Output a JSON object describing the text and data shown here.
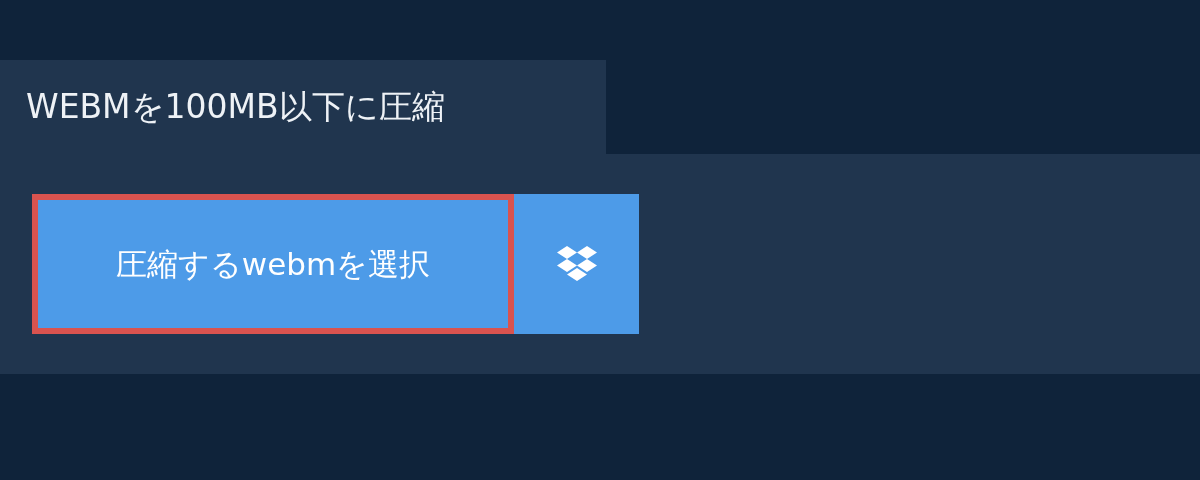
{
  "tab": {
    "title": "WEBMを100MB以下に圧縮"
  },
  "buttons": [
    {
      "kind": "select",
      "label": "圧縮するwebmを選択",
      "focused": true
    },
    {
      "kind": "dropbox",
      "focused": false
    }
  ]
}
